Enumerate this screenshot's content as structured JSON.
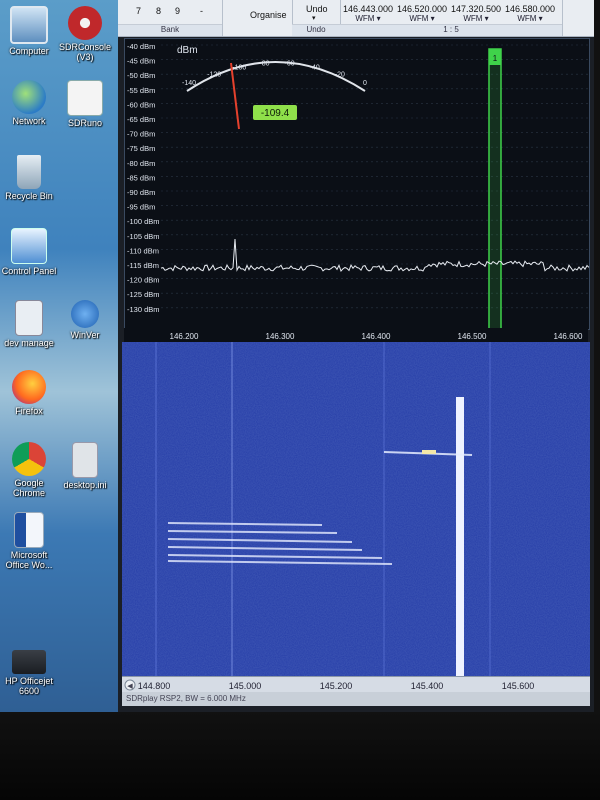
{
  "desktop": {
    "icons": [
      {
        "label": "Computer",
        "name": "computer-icon"
      },
      {
        "label": "SDRConsole (V3)",
        "name": "sdrconsole-icon"
      },
      {
        "label": "Network",
        "name": "network-icon"
      },
      {
        "label": "SDRuno",
        "name": "sdruno-icon"
      },
      {
        "label": "Recycle Bin",
        "name": "recycle-bin-icon"
      },
      {
        "label": "Control Panel",
        "name": "control-panel-icon"
      },
      {
        "label": "dev manage",
        "name": "shortcut-icon"
      },
      {
        "label": "WinVer",
        "name": "shortcut-icon"
      },
      {
        "label": "Firefox",
        "name": "firefox-icon"
      },
      {
        "label": "Google Chrome",
        "name": "chrome-icon"
      },
      {
        "label": "desktop.ini",
        "name": "ini-file-icon"
      },
      {
        "label": "Microsoft Office Wo...",
        "name": "word-icon"
      },
      {
        "label": "HP Officejet 6600",
        "name": "printer-icon"
      }
    ]
  },
  "toolbar": {
    "keys": [
      "7",
      "8",
      "9"
    ],
    "dash": "-",
    "bank_label": "Bank",
    "organise_label": "Organise",
    "undo_button": "Undo",
    "undo_caption": "Undo",
    "memory_group_caption": "1 : 5",
    "memories": [
      {
        "freq": "146.443.000",
        "mode": "WFM"
      },
      {
        "freq": "146.520.000",
        "mode": "WFM"
      },
      {
        "freq": "147.320.500",
        "mode": "WFM"
      },
      {
        "freq": "146.580.000",
        "mode": "WFM"
      }
    ]
  },
  "spectrum": {
    "unit_label": "dBm",
    "y_labels": [
      "-40 dBm",
      "-45 dBm",
      "-50 dBm",
      "-55 dBm",
      "-60 dBm",
      "-65 dBm",
      "-70 dBm",
      "-75 dBm",
      "-80 dBm",
      "-85 dBm",
      "-90 dBm",
      "-95 dBm",
      "-100 dBm",
      "-105 dBm",
      "-110 dBm",
      "-115 dBm",
      "-120 dBm",
      "-125 dBm",
      "-130 dBm"
    ],
    "meter_scale": [
      "-140",
      "-120",
      "-100",
      "-80",
      "-60",
      "-40",
      "-20",
      "0"
    ],
    "signal_level": "-109.4",
    "marker_label": "1",
    "freq_ticks": [
      "146.200",
      "146.300",
      "146.400",
      "146.500",
      "146.600"
    ]
  },
  "waterfall": {
    "freq_ticks": [
      "144.800",
      "145.000",
      "145.200",
      "145.400",
      "145.600"
    ]
  },
  "status": {
    "text": "SDRplay RSP2, BW = 6.000 MHz"
  },
  "colors": {
    "spectrum_bg": "#0b0f16",
    "trace": "#e8ecf2",
    "marker": "#3fd24a",
    "level_badge": "#8fe04a",
    "waterfall_bg": "#2a45b8"
  }
}
